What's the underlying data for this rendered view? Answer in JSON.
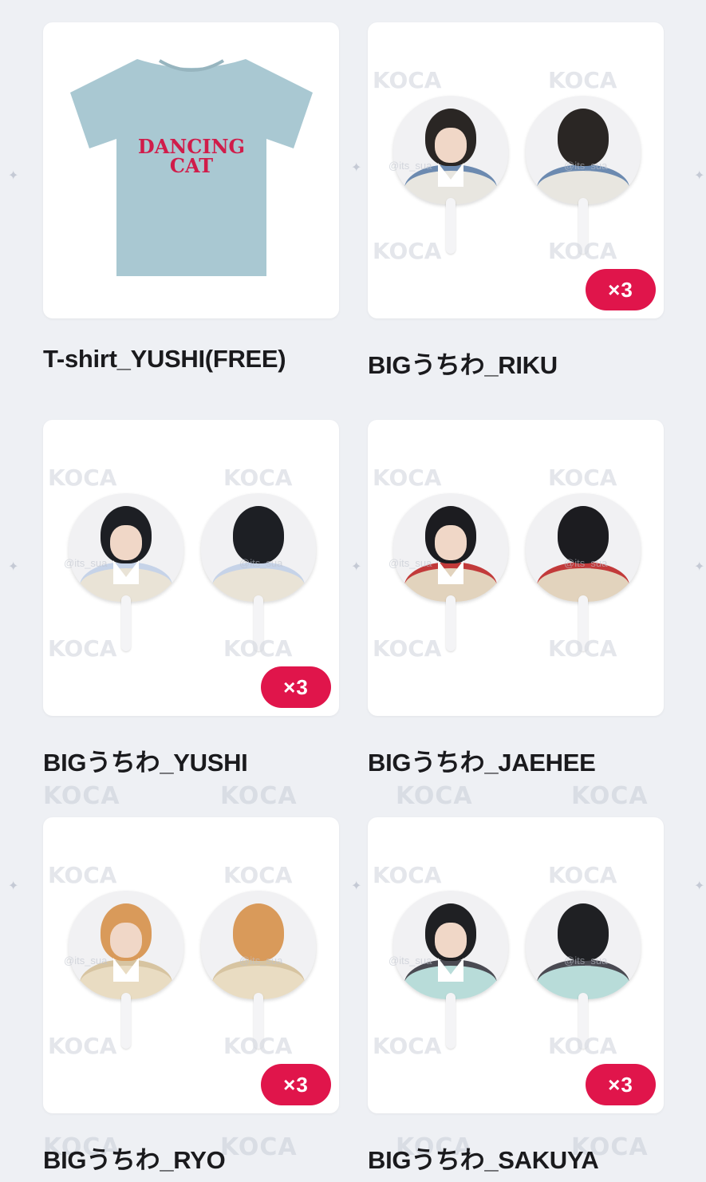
{
  "items": [
    {
      "name": "T-shirt_YUSHI(FREE)",
      "type": "tshirt",
      "shirt_text_line1": "DANCING",
      "shirt_text_line2": "CAT",
      "shirt_color": "#a9c8d2",
      "badge": ""
    },
    {
      "name": "BIGうちわ_RIKU",
      "type": "fan",
      "hair": "#2a2624",
      "outfit": "#e8e6e0",
      "accent": "#6c8ab0",
      "badge": "×3"
    },
    {
      "name": "BIGうちわ_YUSHI",
      "type": "fan",
      "hair": "#1d1f24",
      "outfit": "#e9e3d6",
      "accent": "#c6d3e8",
      "badge": "×3"
    },
    {
      "name": "BIGうちわ_JAEHEE",
      "type": "fan",
      "hair": "#1c1c20",
      "outfit": "#e2d3bd",
      "accent": "#c23a3a",
      "badge": ""
    },
    {
      "name": "BIGうちわ_RYO",
      "type": "fan",
      "hair": "#d99a5a",
      "outfit": "#e9dcc2",
      "accent": "#d7c4a1",
      "badge": "×3"
    },
    {
      "name": "BIGうちわ_SAKUYA",
      "type": "fan",
      "hair": "#1f2023",
      "outfit": "#b8dcd9",
      "accent": "#4a4a52",
      "badge": "×3"
    }
  ],
  "watermark": {
    "brand": "KOCA",
    "handle": "@its_sua"
  },
  "colors": {
    "background": "#eef0f4",
    "badge": "#e0154b",
    "text": "#1a1a1d"
  }
}
